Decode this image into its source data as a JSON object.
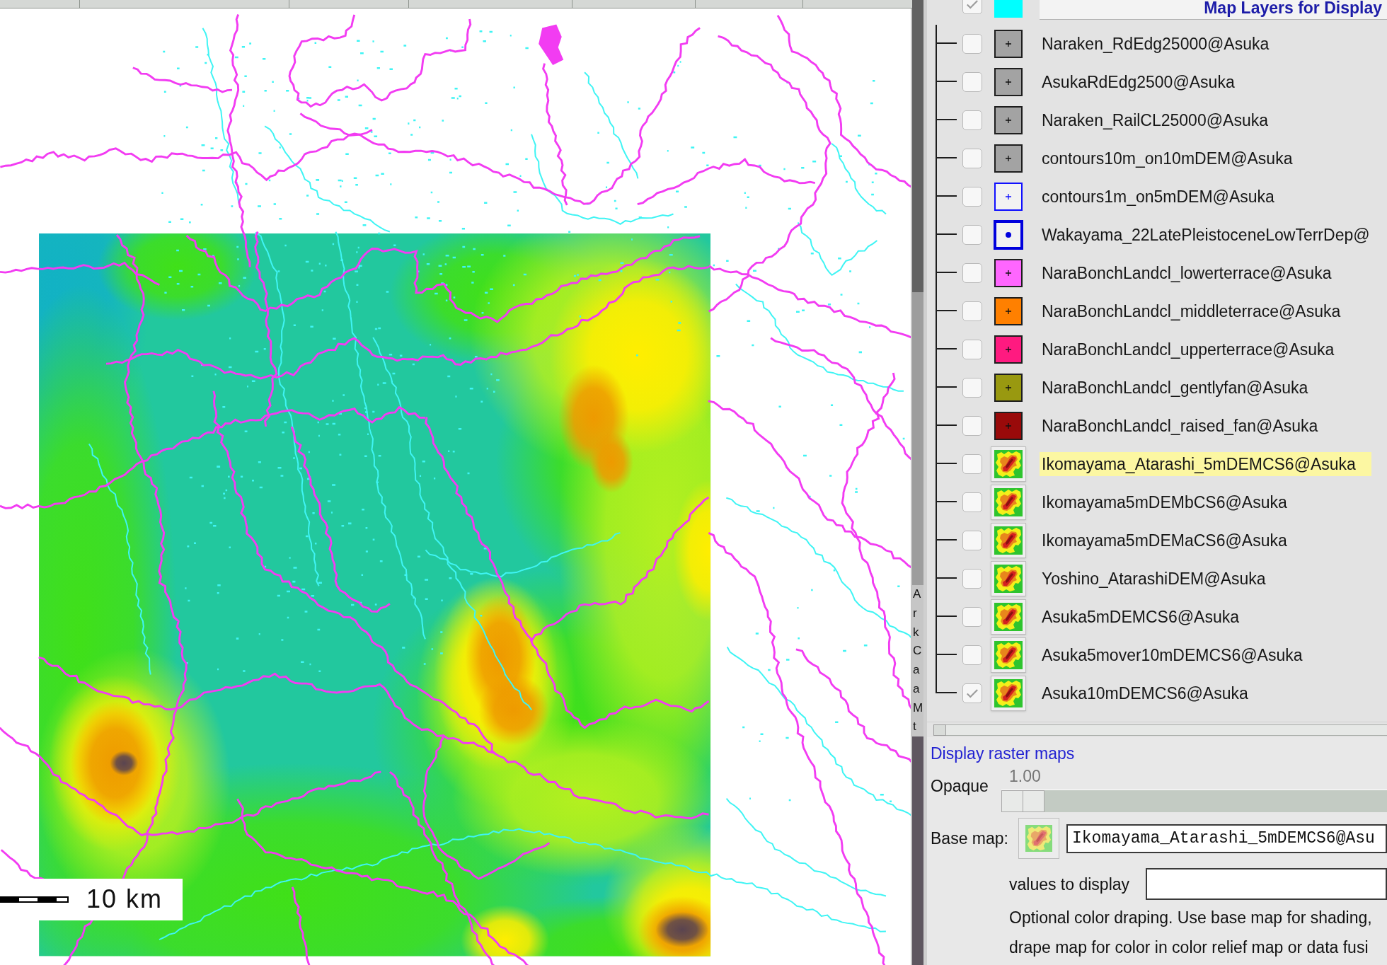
{
  "map": {
    "scale_bar": {
      "label": "10 km"
    }
  },
  "side_strip": {
    "letters": [
      "A",
      "r",
      "k",
      "C",
      "a",
      "a",
      "M",
      "t"
    ]
  },
  "layer_panel": {
    "header": {
      "checked": true,
      "color": "#00ffff",
      "title": "Map Layers for Display"
    },
    "layers": [
      {
        "name": "Naraken_RdEdg25000@Asuka",
        "checked": false,
        "selected": false,
        "swatch": {
          "kind": "area",
          "color": "#a3a3a3"
        }
      },
      {
        "name": "AsukaRdEdg2500@Asuka",
        "checked": false,
        "selected": false,
        "swatch": {
          "kind": "area",
          "color": "#a3a3a3"
        }
      },
      {
        "name": "Naraken_RailCL25000@Asuka",
        "checked": false,
        "selected": false,
        "swatch": {
          "kind": "area",
          "color": "#a3a3a3"
        }
      },
      {
        "name": "contours10m_on10mDEM@Asuka",
        "checked": false,
        "selected": false,
        "swatch": {
          "kind": "area",
          "color": "#a3a3a3"
        }
      },
      {
        "name": "contours1m_on5mDEM@Asuka",
        "checked": false,
        "selected": false,
        "swatch": {
          "kind": "line",
          "color": "#1010ff"
        }
      },
      {
        "name": "Wakayama_22LatePleistoceneLowTerrDep@",
        "checked": false,
        "selected": false,
        "swatch": {
          "kind": "point",
          "color": "#0000dd"
        }
      },
      {
        "name": "NaraBonchLandcl_lowerterrace@Asuka",
        "checked": false,
        "selected": false,
        "swatch": {
          "kind": "area",
          "color": "#ff66ff"
        }
      },
      {
        "name": "NaraBonchLandcl_middleterrace@Asuka",
        "checked": false,
        "selected": false,
        "swatch": {
          "kind": "area",
          "color": "#ff8000"
        }
      },
      {
        "name": "NaraBonchLandcl_upperterrace@Asuka",
        "checked": false,
        "selected": false,
        "swatch": {
          "kind": "area",
          "color": "#ff1a80"
        }
      },
      {
        "name": "NaraBonchLandcl_gentlyfan@Asuka",
        "checked": false,
        "selected": false,
        "swatch": {
          "kind": "area",
          "color": "#999910"
        }
      },
      {
        "name": "NaraBonchLandcl_raised_fan@Asuka",
        "checked": false,
        "selected": false,
        "swatch": {
          "kind": "area",
          "color": "#990a0a"
        }
      },
      {
        "name": "Ikomayama_Atarashi_5mDEMCS6@Asuka",
        "checked": false,
        "selected": true,
        "swatch": {
          "kind": "raster"
        }
      },
      {
        "name": "Ikomayama5mDEMbCS6@Asuka",
        "checked": false,
        "selected": false,
        "swatch": {
          "kind": "raster"
        }
      },
      {
        "name": "Ikomayama5mDEMaCS6@Asuka",
        "checked": false,
        "selected": false,
        "swatch": {
          "kind": "raster"
        }
      },
      {
        "name": "Yoshino_AtarashiDEM@Asuka",
        "checked": false,
        "selected": false,
        "swatch": {
          "kind": "raster"
        }
      },
      {
        "name": "Asuka5mDEMCS6@Asuka",
        "checked": false,
        "selected": false,
        "swatch": {
          "kind": "raster"
        }
      },
      {
        "name": "Asuka5mover10mDEMCS6@Asuka",
        "checked": false,
        "selected": false,
        "swatch": {
          "kind": "raster"
        }
      },
      {
        "name": "Asuka10mDEMCS6@Asuka",
        "checked": true,
        "selected": false,
        "swatch": {
          "kind": "raster"
        }
      }
    ]
  },
  "raster_options": {
    "link": "Display raster maps",
    "opacity": {
      "label": "Opaque",
      "reading": "1.00",
      "level": 0
    },
    "base_map": {
      "label": "Base map:",
      "value": "Ikomayama_Atarashi_5mDEMCS6@Asu"
    },
    "values_to_display": {
      "label": "values to display"
    },
    "help_lines": [
      "Optional color draping. Use base map for shading,",
      "drape map for color in color relief map or data fusi"
    ]
  }
}
